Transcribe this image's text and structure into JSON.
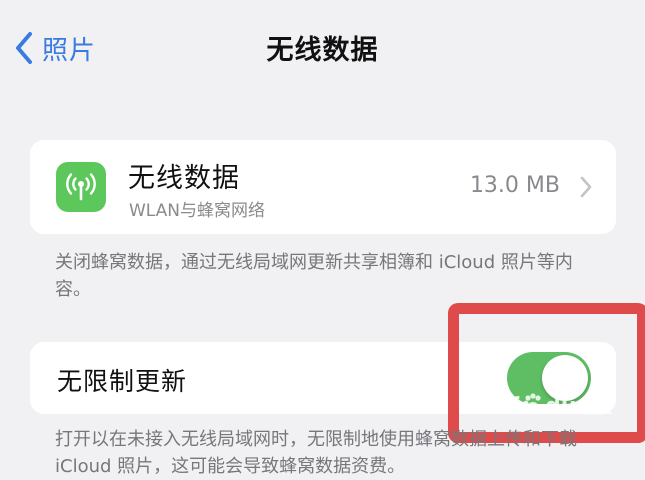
{
  "nav": {
    "back_label": "照片",
    "title": "无线数据"
  },
  "wireless_data": {
    "title": "无线数据",
    "subtitle": "WLAN与蜂窝网络",
    "usage": "13.0 MB"
  },
  "footnote_1": "关闭蜂窝数据，通过无线局域网更新共享相簿和 iCloud 照片等内容。",
  "unlimited_updates": {
    "label": "无限制更新",
    "enabled": true
  },
  "footnote_2": "打开以在未接入无线局域网时，无限制地使用蜂窝数据上传和下载 iCloud 照片，这可能会导致蜂窝数据资费。",
  "watermark": {
    "text_head": "Bai",
    "text_tail": "du",
    "text_cn": "经验"
  },
  "colors": {
    "accent": "#3a7be0",
    "switch_on": "#5fbe63",
    "highlight": "#df4a4a",
    "icon_bg": "#5cc75a"
  }
}
